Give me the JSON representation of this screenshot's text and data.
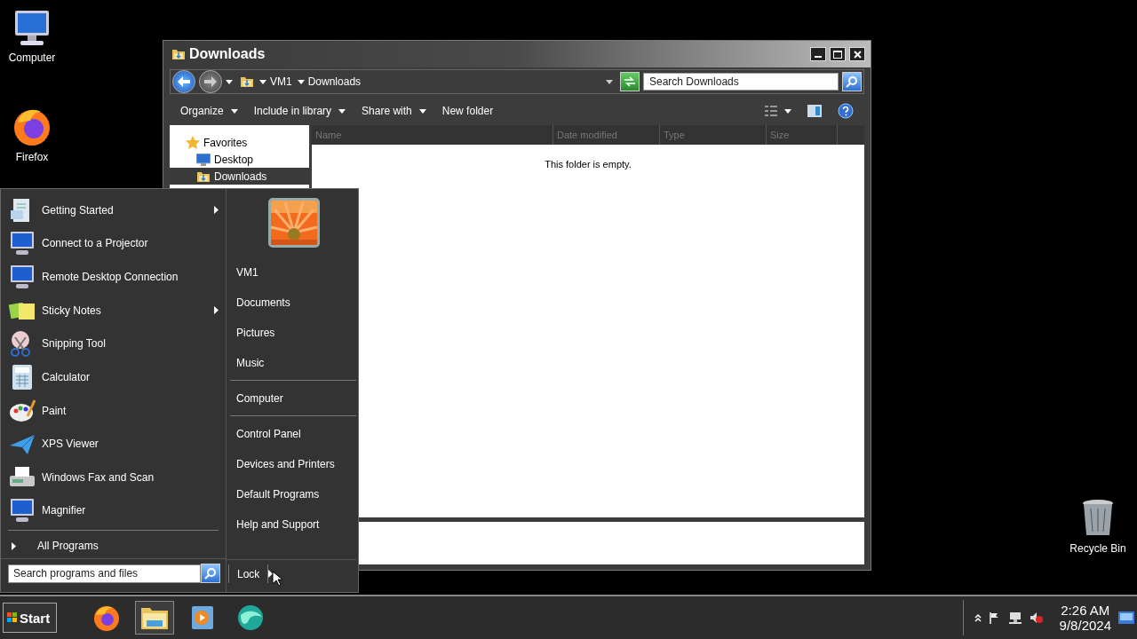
{
  "desktop_icons": [
    {
      "label": "Computer",
      "kind": "computer"
    },
    {
      "label": "Firefox",
      "kind": "firefox"
    },
    {
      "label": "Recycle Bin",
      "kind": "recycle"
    }
  ],
  "explorer": {
    "title": "Downloads",
    "breadcrumb": [
      "VM1",
      "Downloads"
    ],
    "search": {
      "placeholder": "Search Downloads"
    },
    "toolbar": [
      {
        "label": "Organize",
        "dropdown": true
      },
      {
        "label": "Include in library",
        "dropdown": true
      },
      {
        "label": "Share with",
        "dropdown": true
      },
      {
        "label": "New folder",
        "dropdown": false
      }
    ],
    "nav": [
      {
        "label": "Favorites",
        "kind": "star",
        "selected": false
      },
      {
        "label": "Desktop",
        "kind": "desktop",
        "selected": false
      },
      {
        "label": "Downloads",
        "kind": "downloads",
        "selected": true
      }
    ],
    "columns": [
      "Name",
      "Date modified",
      "Type",
      "Size"
    ],
    "empty_message": "This folder is empty."
  },
  "start_menu": {
    "programs": [
      {
        "label": "Getting Started",
        "kind": "document",
        "submenu": true
      },
      {
        "label": "Connect to a Projector",
        "kind": "monitor",
        "submenu": false
      },
      {
        "label": "Remote Desktop Connection",
        "kind": "monitor",
        "submenu": false
      },
      {
        "label": "Sticky Notes",
        "kind": "note",
        "submenu": true
      },
      {
        "label": "Snipping Tool",
        "kind": "scissors",
        "submenu": false
      },
      {
        "label": "Calculator",
        "kind": "calculator",
        "submenu": false
      },
      {
        "label": "Paint",
        "kind": "palette",
        "submenu": false
      },
      {
        "label": "XPS Viewer",
        "kind": "plane",
        "submenu": false
      },
      {
        "label": "Windows Fax and Scan",
        "kind": "printer",
        "submenu": false
      },
      {
        "label": "Magnifier",
        "kind": "monitor",
        "submenu": false
      }
    ],
    "all_programs": "All Programs",
    "search": {
      "placeholder": "Search programs and files"
    },
    "place_groups": [
      [
        "VM1",
        "Documents",
        "Pictures",
        "Music"
      ],
      [
        "Computer"
      ],
      [
        "Control Panel",
        "Devices and Printers",
        "Default Programs",
        "Help and Support"
      ]
    ],
    "lock": "Lock"
  },
  "taskbar": {
    "start": "Start",
    "pinned": [
      {
        "kind": "firefox",
        "selected": false
      },
      {
        "kind": "folder",
        "selected": true
      },
      {
        "kind": "media",
        "selected": false
      },
      {
        "kind": "browser",
        "selected": false
      }
    ],
    "clock": {
      "time": "2:26 AM",
      "date": "9/8/2024"
    }
  }
}
